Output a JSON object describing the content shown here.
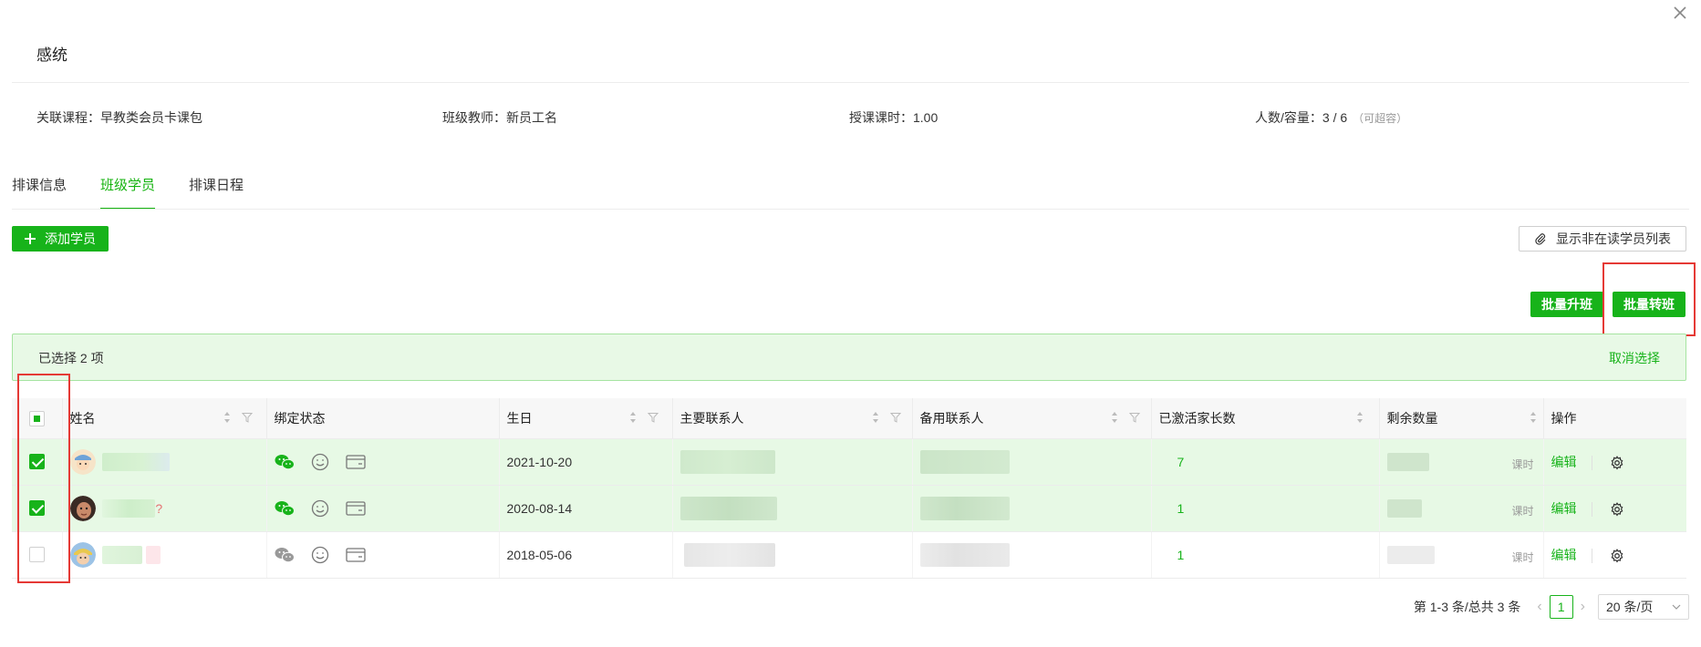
{
  "dialog": {
    "title": "感统",
    "close_icon": "close-icon"
  },
  "info": {
    "course_label": "关联课程：",
    "course_value": "早教类会员卡课包",
    "teacher_label": "班级教师：",
    "teacher_value": "新员工名",
    "hours_label": "授课课时：",
    "hours_value": "1.00",
    "capacity_label": "人数/容量：",
    "capacity_value": "3 / 6",
    "capacity_note": "（可超容）"
  },
  "tabs": [
    {
      "label": "排课信息",
      "active": false
    },
    {
      "label": "班级学员",
      "active": true
    },
    {
      "label": "排课日程",
      "active": false
    }
  ],
  "toolbar": {
    "add_label": "添加学员",
    "show_inactive_label": "显示非在读学员列表",
    "batch_upgrade_label": "批量升班",
    "batch_transfer_label": "批量转班"
  },
  "selection": {
    "text": "已选择  2  项",
    "cancel_label": "取消选择"
  },
  "table": {
    "headers": [
      "姓名",
      "绑定状态",
      "生日",
      "主要联系人",
      "备用联系人",
      "已激活家长数",
      "剩余数量",
      "操作"
    ],
    "rows": [
      {
        "checked": true,
        "birthday": "2021-10-20",
        "activated": "7",
        "unit": "课时",
        "edit": "编辑"
      },
      {
        "checked": true,
        "birthday": "2020-08-14",
        "activated": "1",
        "unit": "课时",
        "edit": "编辑"
      },
      {
        "checked": false,
        "birthday": "2018-05-06",
        "activated": "1",
        "unit": "课时",
        "edit": "编辑"
      }
    ]
  },
  "pagination": {
    "summary": "第 1-3 条/总共 3 条",
    "current_page": "1",
    "page_size": "20 条/页"
  },
  "colors": {
    "accent": "#17b31a",
    "selected_row": "#e7f9e5",
    "highlight_box": "#e53935"
  }
}
